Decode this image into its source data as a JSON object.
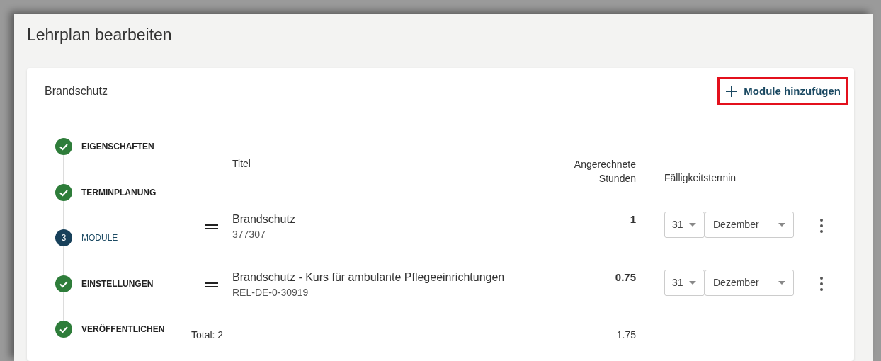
{
  "page_title": "Lehrplan bearbeiten",
  "card": {
    "title": "Brandschutz",
    "add_button": {
      "label": "Module hinzufügen",
      "highlighted": true
    }
  },
  "steps": [
    {
      "label": "EIGENSCHAFTEN",
      "kind": "done",
      "selected": false
    },
    {
      "label": "TERMINPLANUNG",
      "kind": "done",
      "selected": false
    },
    {
      "label": "MODULE",
      "kind": "current",
      "number": "3",
      "selected": true
    },
    {
      "label": "EINSTELLUNGEN",
      "kind": "done",
      "selected": false
    },
    {
      "label": "VERÖFFENTLICHEN",
      "kind": "done",
      "selected": false
    }
  ],
  "table": {
    "columns": [
      "Titel",
      "Angerechnete Stunden",
      "Fälligkeitstermin"
    ],
    "rows": [
      {
        "title": "Brandschutz",
        "code": "377307",
        "hours": "1",
        "day": "31",
        "month": "Dezember"
      },
      {
        "title": "Brandschutz - Kurs für ambulante Pflegeeinrichtungen",
        "code": "REL-DE-0-30919",
        "hours": "0.75",
        "day": "31",
        "month": "Dezember"
      }
    ],
    "total_label": "Total: 2",
    "total_hours": "1.75"
  }
}
